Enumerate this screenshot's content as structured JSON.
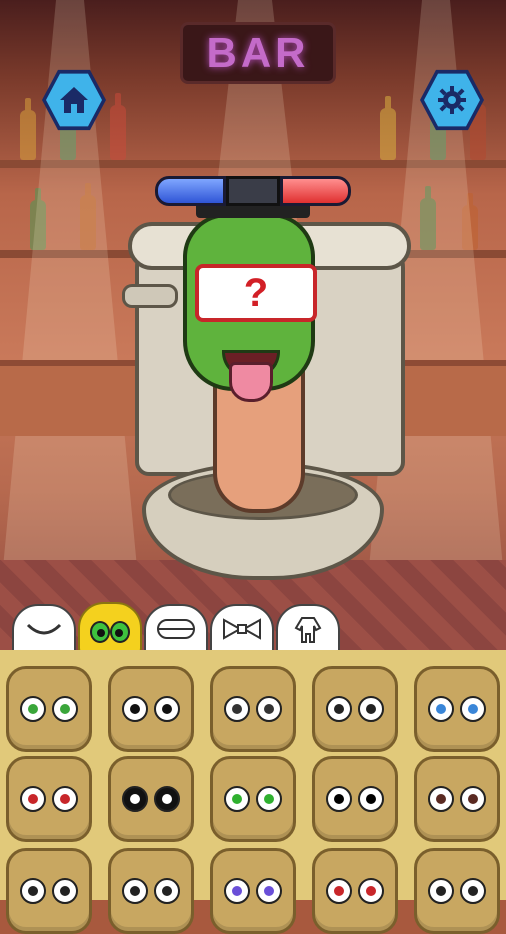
{
  "scene": {
    "bar_sign": "BAR",
    "mystery_mark": "?"
  },
  "nav": {
    "home_icon": "home-icon",
    "settings_icon": "gear-icon"
  },
  "category_tabs": [
    {
      "name": "mouth-tab",
      "icon": "mouth"
    },
    {
      "name": "eyes-tab",
      "icon": "eyes",
      "active": true
    },
    {
      "name": "teeth-tab",
      "icon": "teeth"
    },
    {
      "name": "bowtie-tab",
      "icon": "bowtie"
    },
    {
      "name": "body-tab",
      "icon": "body"
    }
  ],
  "eye_options": [
    {
      "name": "green-eyes",
      "iris": "#3aa63a"
    },
    {
      "name": "oval-black-eyes",
      "iris": "#111111"
    },
    {
      "name": "teary-eyes",
      "iris": "#333333"
    },
    {
      "name": "cartoon-eyes",
      "iris": "#222222"
    },
    {
      "name": "blue-eyes",
      "iris": "#3a86d8"
    },
    {
      "name": "red-strain-eyes",
      "iris": "#c8262a"
    },
    {
      "name": "white-eyes",
      "iris": "#ffffff"
    },
    {
      "name": "bright-green-eyes",
      "iris": "#2fb02f"
    },
    {
      "name": "dark-eyes",
      "iris": "#000000"
    },
    {
      "name": "narrow-eyes",
      "iris": "#5a2a22"
    },
    {
      "name": "closed-eyes",
      "iris": "#222222"
    },
    {
      "name": "round-eyes",
      "iris": "#222222"
    },
    {
      "name": "one-eye",
      "iris": "#6a4fd8"
    },
    {
      "name": "angry-eyes",
      "iris": "#c8262a"
    },
    {
      "name": "sad-eyes",
      "iris": "#222222"
    }
  ]
}
